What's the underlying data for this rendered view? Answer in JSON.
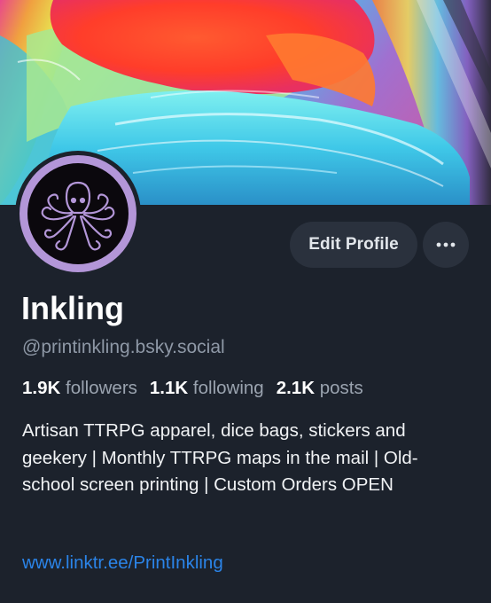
{
  "profile": {
    "display_name": "Inkling",
    "handle": "@printinkling.bsky.social",
    "bio": "Artisan TTRPG apparel, dice bags, stickers and geekery | Monthly TTRPG maps in the mail | Old-school screen printing | Custom Orders OPEN",
    "link": "www.linktr.ee/PrintInkling"
  },
  "stats": {
    "followers": {
      "count": "1.9K",
      "label": "followers"
    },
    "following": {
      "count": "1.1K",
      "label": "following"
    },
    "posts": {
      "count": "2.1K",
      "label": "posts"
    }
  },
  "actions": {
    "edit_profile": "Edit Profile",
    "more_icon": "ellipsis-icon"
  },
  "media": {
    "banner": "rainbow-ink-swirl-banner",
    "avatar": "octopus-avatar"
  },
  "colors": {
    "background": "#1c222c",
    "button_bg": "#2a313d",
    "link": "#2b84e8",
    "muted_text": "#8e98a6",
    "avatar_ring": "#b396d8"
  }
}
